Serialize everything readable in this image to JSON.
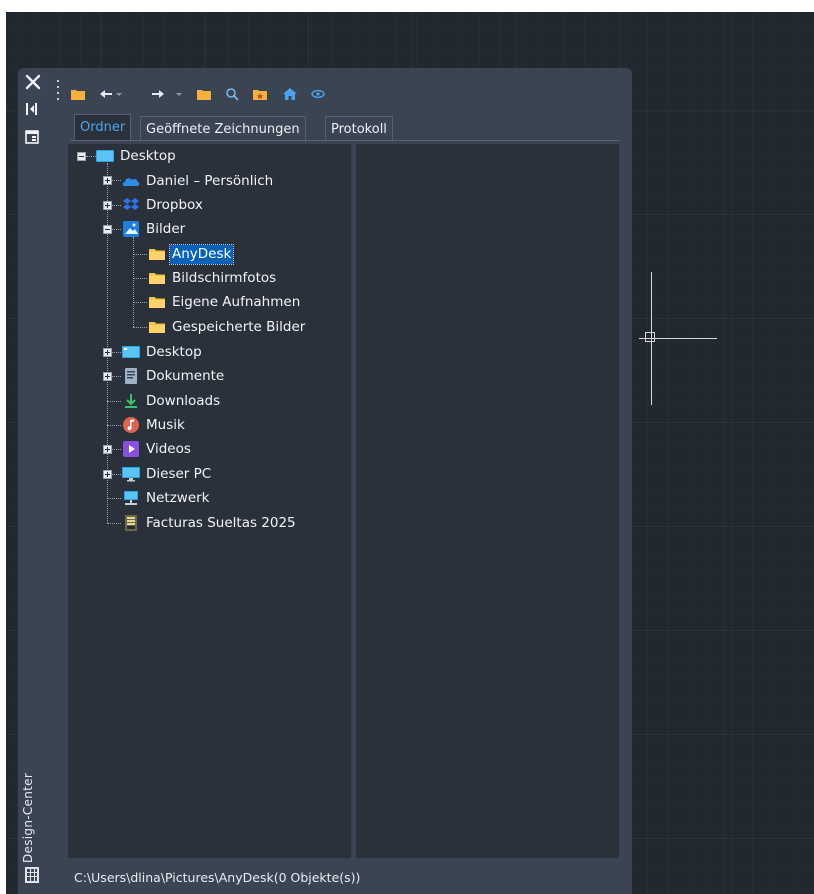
{
  "palette": {
    "title": "Design-Center",
    "status_path": "C:\\Users\\dlina\\Pictures\\AnyDesk(0 Objekte(s))"
  },
  "tabs": [
    {
      "label": "Ordner",
      "active": true
    },
    {
      "label": "Geöffnete Zeichnungen",
      "active": false
    },
    {
      "label": "Protokoll",
      "active": false
    }
  ],
  "toolbar": [
    {
      "icon": "load-folder-icon"
    },
    {
      "icon": "back-arrow-icon"
    },
    {
      "icon": "dropdown-caret-icon"
    },
    {
      "icon": "forward-arrow-icon"
    },
    {
      "icon": "dropdown-caret-icon"
    },
    {
      "icon": "up-folder-icon"
    },
    {
      "icon": "search-icon"
    },
    {
      "icon": "favorites-folder-icon"
    },
    {
      "icon": "home-icon"
    },
    {
      "icon": "preview-eye-icon"
    }
  ],
  "tree": [
    {
      "label": "Desktop",
      "icon": "desktop-icon",
      "level": 0,
      "expander": "minus"
    },
    {
      "label": "Daniel – Persönlich",
      "icon": "onedrive-icon",
      "level": 1,
      "expander": "plus"
    },
    {
      "label": "Dropbox",
      "icon": "dropbox-icon",
      "level": 1,
      "expander": "plus"
    },
    {
      "label": "Bilder",
      "icon": "pictures-icon",
      "level": 1,
      "expander": "minus"
    },
    {
      "label": "AnyDesk",
      "icon": "folder-icon",
      "level": 2,
      "expander": "none",
      "selected": true
    },
    {
      "label": "Bildschirmfotos",
      "icon": "folder-icon",
      "level": 2,
      "expander": "none"
    },
    {
      "label": "Eigene Aufnahmen",
      "icon": "folder-icon",
      "level": 2,
      "expander": "none"
    },
    {
      "label": "Gespeicherte Bilder",
      "icon": "folder-icon",
      "level": 2,
      "expander": "none"
    },
    {
      "label": "Desktop",
      "icon": "desktop-folder-icon",
      "level": 1,
      "expander": "plus"
    },
    {
      "label": "Dokumente",
      "icon": "documents-icon",
      "level": 1,
      "expander": "plus"
    },
    {
      "label": "Downloads",
      "icon": "downloads-icon",
      "level": 1,
      "expander": "none"
    },
    {
      "label": "Musik",
      "icon": "music-icon",
      "level": 1,
      "expander": "none"
    },
    {
      "label": "Videos",
      "icon": "videos-icon",
      "level": 1,
      "expander": "plus"
    },
    {
      "label": "Dieser PC",
      "icon": "this-pc-icon",
      "level": 1,
      "expander": "plus"
    },
    {
      "label": "Netzwerk",
      "icon": "network-icon",
      "level": 1,
      "expander": "none"
    },
    {
      "label": "Facturas Sueltas 2025",
      "icon": "archive-icon",
      "level": 1,
      "expander": "none"
    }
  ],
  "colors": {
    "canvas_bg": "#212830",
    "palette_bg": "#3b4453",
    "pane_bg": "#2b313b",
    "accent": "#49a6f3",
    "selection": "#0a63b8",
    "folder_yellow": "#f6c34a"
  }
}
